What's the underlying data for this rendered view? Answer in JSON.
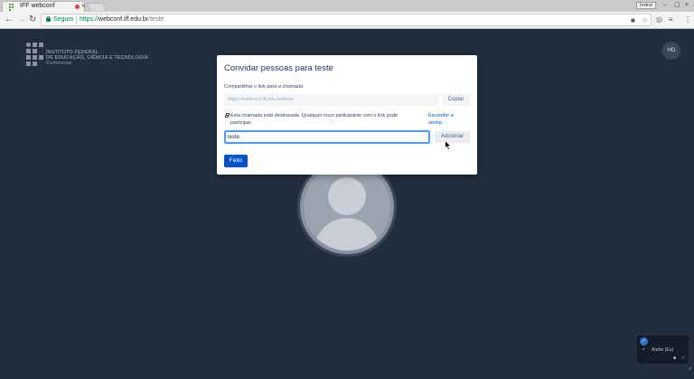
{
  "browser": {
    "tab_title": "IFF webconf",
    "tab_close": "×",
    "user_chip": "Instrut",
    "window_controls": [
      "–",
      "▢",
      "×"
    ],
    "security_label": "Seguro",
    "url_scheme": "https://",
    "url_host": "webconf.iff.edu.br",
    "url_path": "/teste",
    "nav_icons": [
      "back-icon",
      "forward-icon",
      "reload-icon"
    ],
    "toolbar_icons": [
      "camera-icon",
      "star-icon",
      "extension-icon",
      "menu-icon"
    ]
  },
  "page": {
    "logo": {
      "line1": "INSTITUTO FEDERAL",
      "line2": "DE EDUCAÇÃO, CIÊNCIA E TECNOLOGIA",
      "line3": "Fluminense"
    },
    "local_avatar_initials": "HD",
    "filmstrip": {
      "name": "Andre (Eu)"
    }
  },
  "dialog": {
    "title": "Convidar pessoas para teste",
    "share_label": "Compartilhar o link para a chamada",
    "link_value": "https://webconf.iff.edu.br/teste",
    "copy_label": "Copiar",
    "lock_message": "Esta chamada está destravada. Qualquer novo participante com o link pode participar.",
    "hide_password_label": "Esconder a senha",
    "invite_value": "teste",
    "add_label": "Adicionar",
    "done_label": "Feito"
  },
  "colors": {
    "page_background": "#222d3d",
    "primary_button": "#0052cc",
    "secure_green": "#0b8043",
    "focus_ring": "#4c9aff"
  }
}
